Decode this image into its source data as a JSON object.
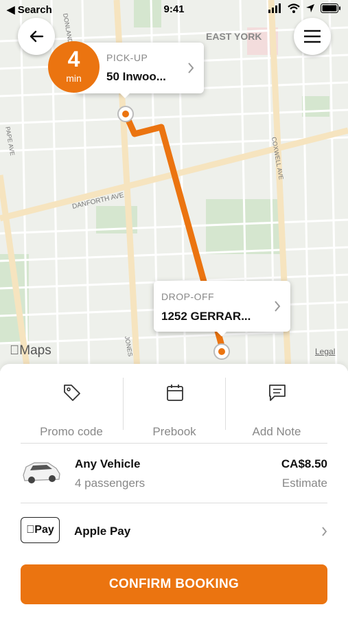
{
  "status_bar": {
    "back_app": "◀ Search",
    "time": "9:41"
  },
  "map": {
    "labels": {
      "east_york": "EAST YORK",
      "danforth": "DANFORTH AVE",
      "pape": "PAPE AVE",
      "coxwell": "COXWELL AVE",
      "jones": "JONES",
      "donlands": "DONLANDS"
    },
    "maps_logo": "Maps",
    "legal": "Legal",
    "route_color": "#eb7410"
  },
  "eta": {
    "value": "4",
    "unit": "min"
  },
  "pickup": {
    "label": "PICK-UP",
    "address": "50 Inwoo..."
  },
  "dropoff": {
    "label": "DROP-OFF",
    "address": "1252 GERRAR..."
  },
  "actions": [
    {
      "label": "Promo code",
      "icon": "tag-icon"
    },
    {
      "label": "Prebook",
      "icon": "calendar-icon"
    },
    {
      "label": "Add Note",
      "icon": "note-icon"
    }
  ],
  "vehicle": {
    "name": "Any Vehicle",
    "passengers": "4 passengers",
    "price": "CA$8.50",
    "price_note": "Estimate"
  },
  "payment": {
    "badge": "Pay",
    "method": "Apple Pay"
  },
  "confirm_label": "CONFIRM BOOKING",
  "colors": {
    "accent": "#eb7410"
  }
}
